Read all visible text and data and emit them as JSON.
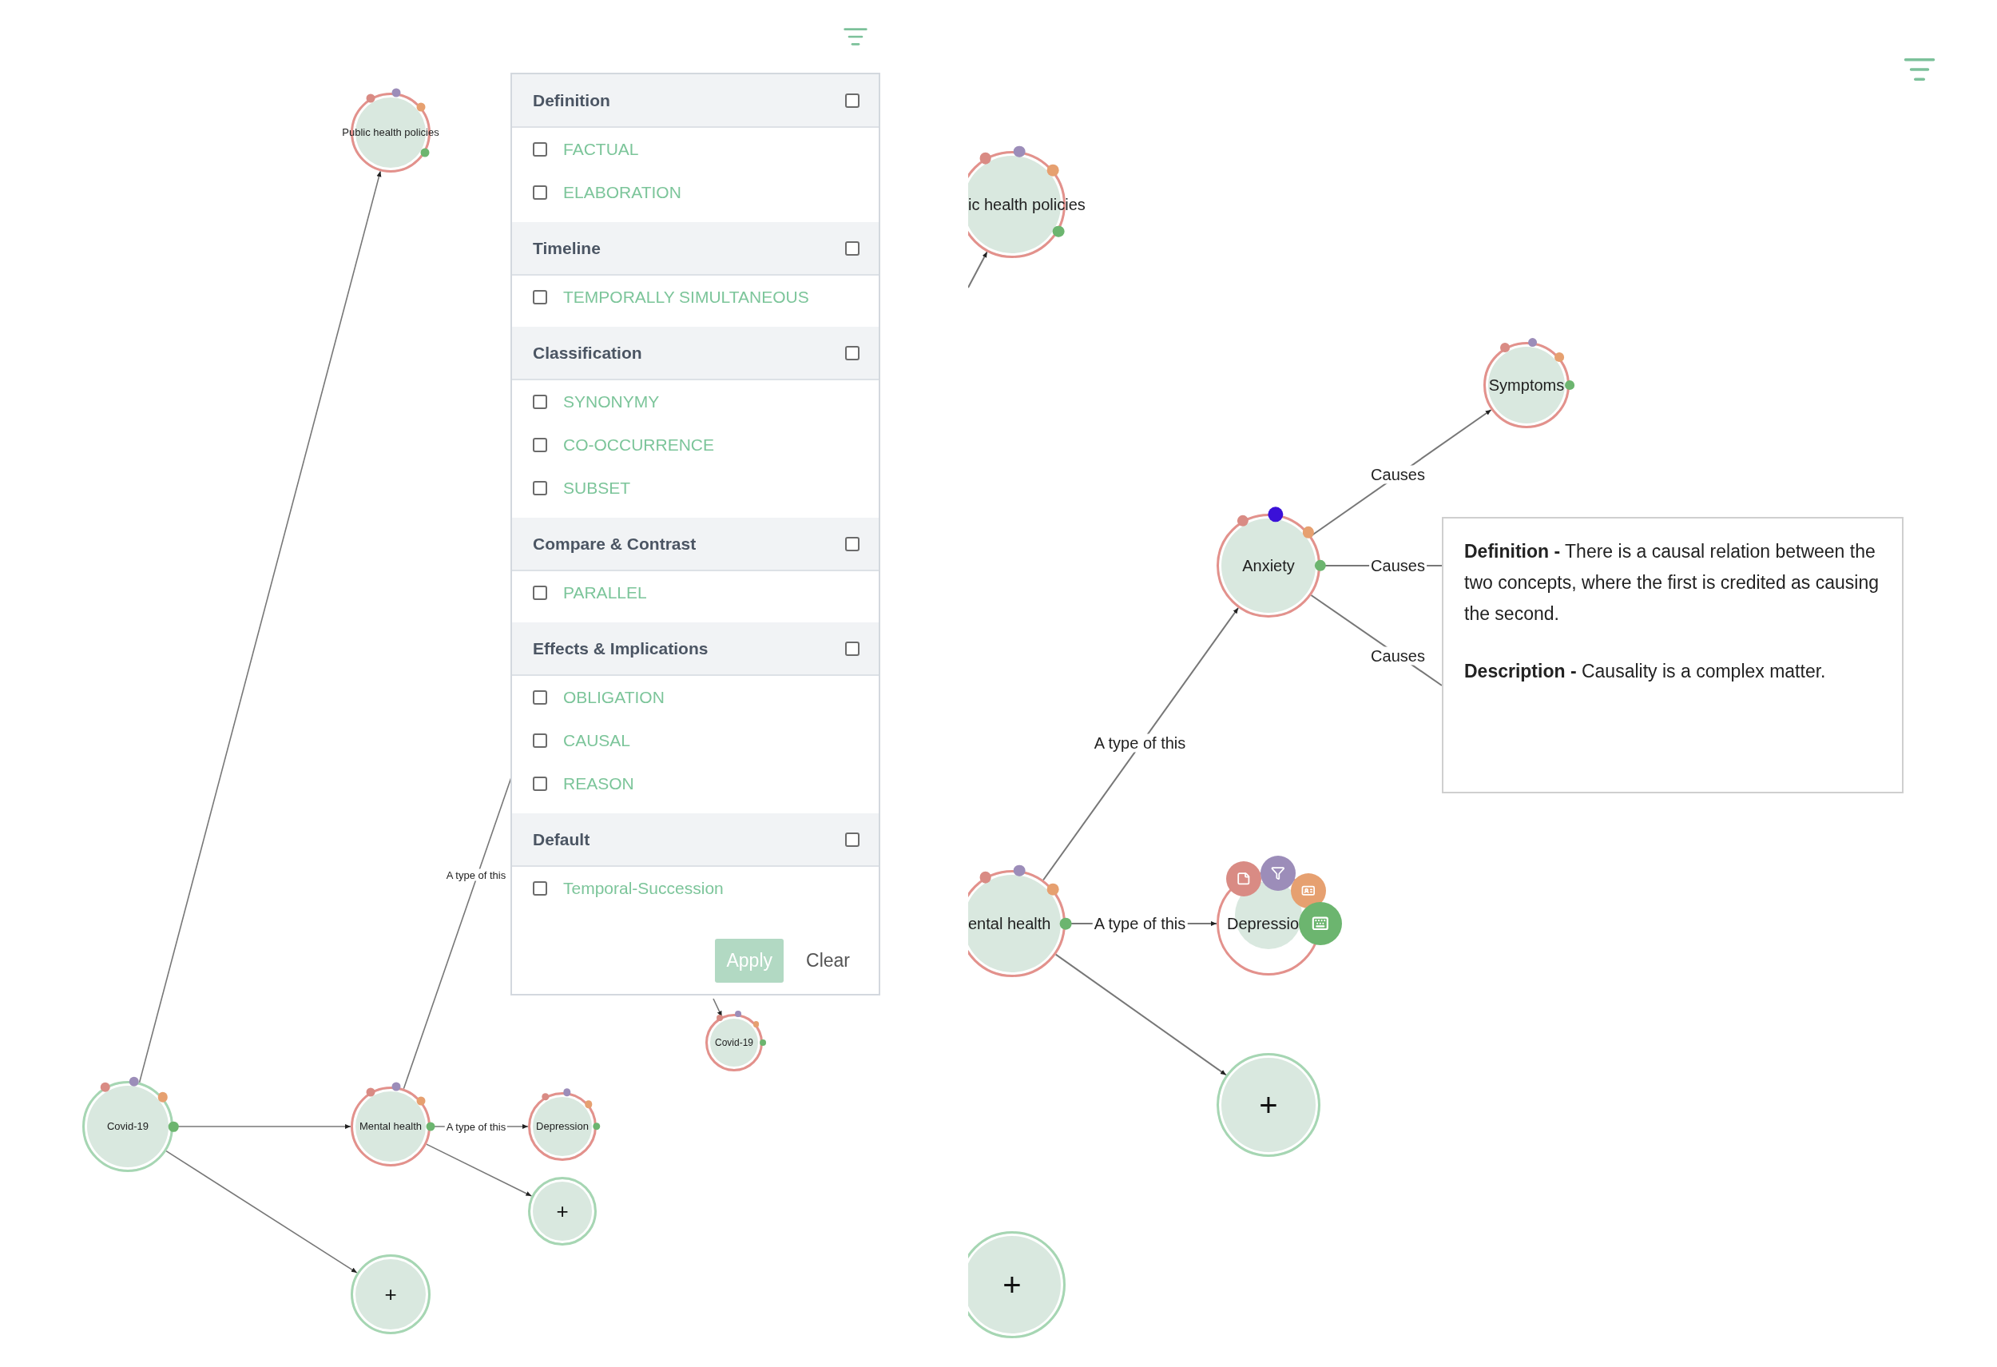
{
  "left_view": {
    "nodes": [
      {
        "kind": "concept",
        "label": "Public health policies",
        "active": false
      },
      {
        "kind": "concept",
        "label": "Covid-19",
        "active": false
      },
      {
        "kind": "root",
        "label": "Covid-19",
        "active": false
      },
      {
        "kind": "concept",
        "label": "Mental health",
        "active": false
      },
      {
        "kind": "concept",
        "label": "Depression",
        "active": false
      },
      {
        "kind": "add",
        "label": "+"
      },
      {
        "kind": "add",
        "label": "+"
      }
    ],
    "edge_labels": [
      "A type of this",
      "A type of this"
    ]
  },
  "filter_panel": {
    "groups": [
      {
        "title": "Definition",
        "checked": false,
        "options": [
          {
            "label": "FACTUAL",
            "checked": false
          },
          {
            "label": "ELABORATION",
            "checked": false
          }
        ]
      },
      {
        "title": "Timeline",
        "checked": false,
        "options": [
          {
            "label": "TEMPORALLY SIMULTANEOUS",
            "checked": false
          }
        ]
      },
      {
        "title": "Classification",
        "checked": false,
        "options": [
          {
            "label": "SYNONYMY",
            "checked": false
          },
          {
            "label": "CO-OCCURRENCE",
            "checked": false
          },
          {
            "label": "SUBSET",
            "checked": false
          }
        ]
      },
      {
        "title": "Compare & Contrast",
        "checked": false,
        "options": [
          {
            "label": "PARALLEL",
            "checked": false
          }
        ]
      },
      {
        "title": "Effects & Implications",
        "checked": false,
        "options": [
          {
            "label": "OBLIGATION",
            "checked": false
          },
          {
            "label": "CAUSAL",
            "checked": false
          },
          {
            "label": "REASON",
            "checked": false
          }
        ]
      },
      {
        "title": "Default",
        "checked": false,
        "options": [
          {
            "label": "Temporal-Succession",
            "checked": false
          }
        ]
      }
    ],
    "apply": {
      "label": "Apply",
      "disabled": true
    },
    "clear": {
      "label": "Clear"
    }
  },
  "right_view": {
    "nodes": [
      {
        "kind": "concept",
        "label": "ic health policies",
        "active": false
      },
      {
        "kind": "concept",
        "label": "Symptoms",
        "active": false
      },
      {
        "kind": "concept",
        "label": "Anxiety",
        "active": true
      },
      {
        "kind": "concept",
        "label": "ental health",
        "active": false
      },
      {
        "kind": "menu",
        "label": "Depressio"
      },
      {
        "kind": "add",
        "label": "+"
      },
      {
        "kind": "add",
        "label": "+"
      }
    ],
    "edge_labels": [
      "Causes",
      "Causes",
      "Causes",
      "A type of this",
      "A type of this"
    ],
    "tooltip": {
      "paragraphs": [
        "**Definition -** There is a causal relation between the two concepts, where the first is credited as causing the second.",
        "**Description -** Causality is a complex matter."
      ]
    }
  }
}
